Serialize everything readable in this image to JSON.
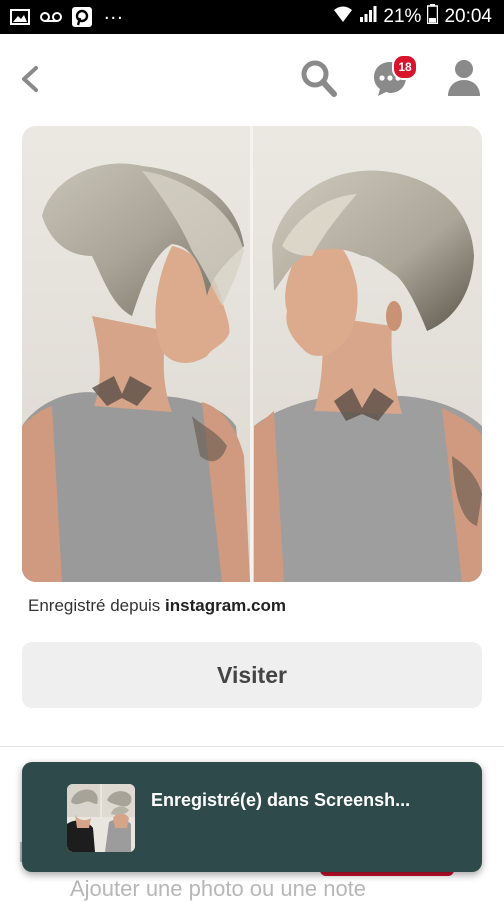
{
  "status_bar": {
    "battery": "21%",
    "time": "20:04",
    "dots": "..."
  },
  "header": {
    "back_icon": "chevron-left-icon",
    "search_icon": "search-icon",
    "messages_icon": "chat-bubble-icon",
    "messages_badge": "18",
    "profile_icon": "profile-icon"
  },
  "pin": {
    "image_alt": "short-hair-photo",
    "saved_from_prefix": "Enregistré depuis ",
    "saved_from_domain": "instagram.com",
    "visit_label": "Visiter"
  },
  "toast": {
    "message": "Enregistré(e) dans Screensh..."
  },
  "below": {
    "partial_text": "Ajouter une photo ou une note"
  },
  "colors": {
    "badge": "#d7142c",
    "toast_bg": "#2f4a4a",
    "button_bg": "#efefef",
    "accent_red": "#c8102e"
  }
}
